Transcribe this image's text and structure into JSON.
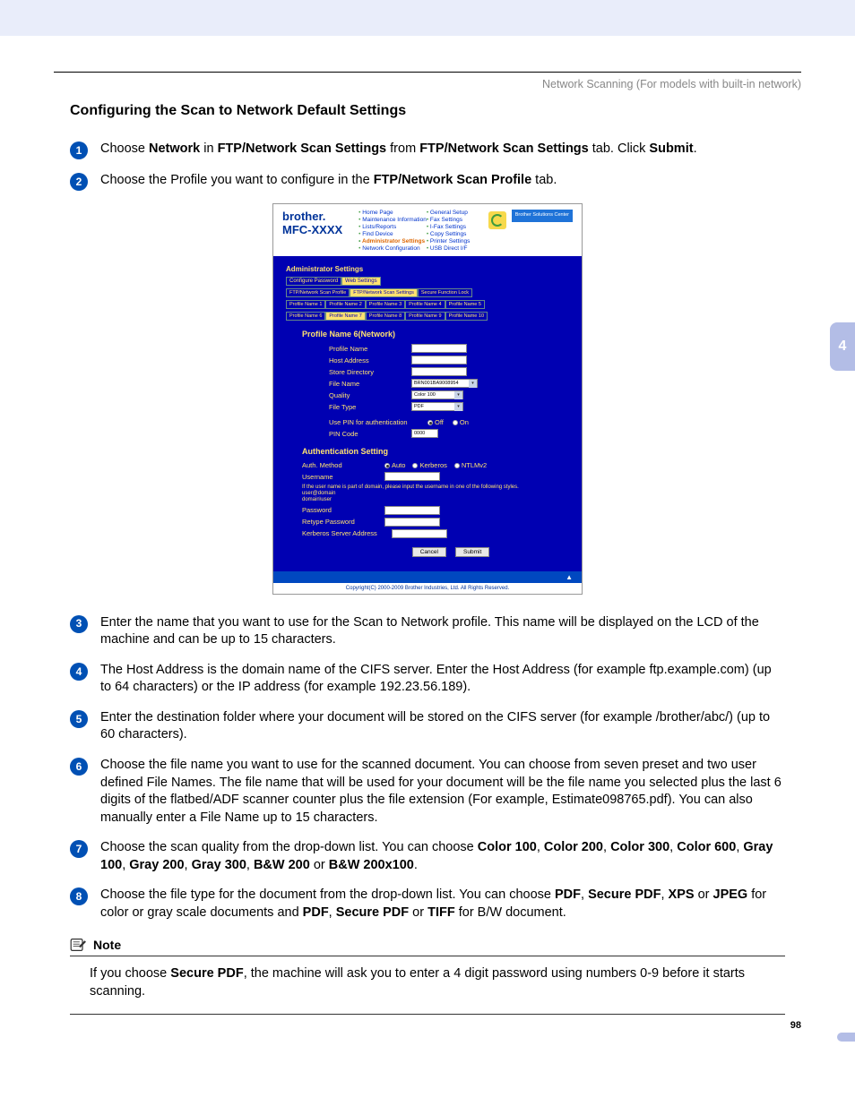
{
  "breadcrumb": "Network Scanning (For models with built-in network)",
  "title": "Configuring the Scan to Network Default Settings",
  "side_tab": "4",
  "page_number": "98",
  "steps": {
    "s1_a": "Choose ",
    "s1_b": "Network",
    "s1_c": " in ",
    "s1_d": "FTP/Network Scan Settings",
    "s1_e": " from ",
    "s1_f": "FTP/Network Scan Settings",
    "s1_g": " tab. Click ",
    "s1_h": "Submit",
    "s1_i": ".",
    "s2_a": "Choose the Profile you want to configure in the ",
    "s2_b": "FTP/Network Scan Profile",
    "s2_c": " tab.",
    "s3": "Enter the name that you want to use for the Scan to Network profile. This name will be displayed on the LCD of the machine and can be up to 15 characters.",
    "s4": "The Host Address is the domain name of the CIFS server. Enter the Host Address (for example ftp.example.com) (up to 64 characters) or the IP address (for example 192.23.56.189).",
    "s5": "Enter the destination folder where your document will be stored on the CIFS server (for example /brother/abc/) (up to 60 characters).",
    "s6": "Choose the file name you want to use for the scanned document. You can choose from seven preset and two user defined File Names. The file name that will be used for your document will be the file name you selected plus the last 6 digits of the flatbed/ADF scanner counter plus the file extension (For example, Estimate098765.pdf). You can also manually enter a File Name up to 15 characters.",
    "s7_a": "Choose the scan quality from the drop-down list. You can choose ",
    "s7_opts": [
      "Color 100",
      "Color 200",
      "Color 300",
      "Color 600",
      "Gray 100",
      "Gray 200",
      "Gray 300",
      "B&W 200",
      "B&W 200x100"
    ],
    "s7_end": ".",
    "s8_a": "Choose the file type for the document from the drop-down list. You can choose ",
    "s8_b": "PDF",
    "s8_c": ", ",
    "s8_d": "Secure PDF",
    "s8_e": ", ",
    "s8_f": "XPS",
    "s8_g": " or ",
    "s8_h": "JPEG",
    "s8_i": " for color or gray scale documents and ",
    "s8_j": "PDF",
    "s8_k": ", ",
    "s8_l": "Secure PDF",
    "s8_m": " or ",
    "s8_n": "TIFF",
    "s8_o": " for B/W document."
  },
  "note": {
    "label": "Note",
    "text_a": "If you choose ",
    "text_b": "Secure PDF",
    "text_c": ", the machine will ask you to enter a 4 digit password using numbers 0-9 before it starts scanning."
  },
  "shot": {
    "brand": "brother.",
    "model": "MFC-XXXX",
    "nav1": [
      "Home Page",
      "Maintenance Information",
      "Lists/Reports",
      "Find Device",
      "Administrator Settings",
      "Network Configuration"
    ],
    "nav2": [
      "General Setup",
      "Fax Settings",
      "I-Fax Settings",
      "Copy Settings",
      "Printer Settings",
      "USB Direct I/F"
    ],
    "solcenter": "Brother Solutions Center",
    "as_title": "Administrator Settings",
    "tabs1": [
      "Configure Password",
      "Web Settings"
    ],
    "tabs2": [
      "FTP/Network Scan Profile",
      "FTP/Network Scan Settings",
      "Secure Function Lock"
    ],
    "tabs3": [
      "Profile Name 1",
      "Profile Name 2",
      "Profile Name 3",
      "Profile Name 4",
      "Profile Name 5"
    ],
    "tabs4": [
      "Profile Name 6",
      "Profile Name 7",
      "Profile Name 8",
      "Profile Name 9",
      "Profile Name 10"
    ],
    "section1": "Profile Name 6(Network)",
    "rows": {
      "profile_name": "Profile Name",
      "host_address": "Host Address",
      "store_directory": "Store Directory",
      "file_name": "File Name",
      "file_name_val": "BRN001BA9008954",
      "quality": "Quality",
      "quality_val": "Color 100",
      "file_type": "File Type",
      "file_type_val": "PDF",
      "use_pin": "Use PIN for authentication",
      "off": "Off",
      "on": "On",
      "pin_code": "PIN Code",
      "pin_val": "0000"
    },
    "section2": "Authentication Setting",
    "auth": {
      "method": "Auth. Method",
      "auto": "Auto",
      "kerberos": "Kerberos",
      "ntlm": "NTLMv2",
      "username": "Username",
      "hint": "If the user name is part of domain, please input the username in one of the following styles.\nuser@domain\ndomain\\user",
      "password": "Password",
      "retype": "Retype Password",
      "kserver": "Kerberos Server Address"
    },
    "cancel": "Cancel",
    "submit": "Submit",
    "backtop": "▲",
    "copyright": "Copyright(C) 2000-2009 Brother Industries, Ltd. All Rights Reserved."
  }
}
